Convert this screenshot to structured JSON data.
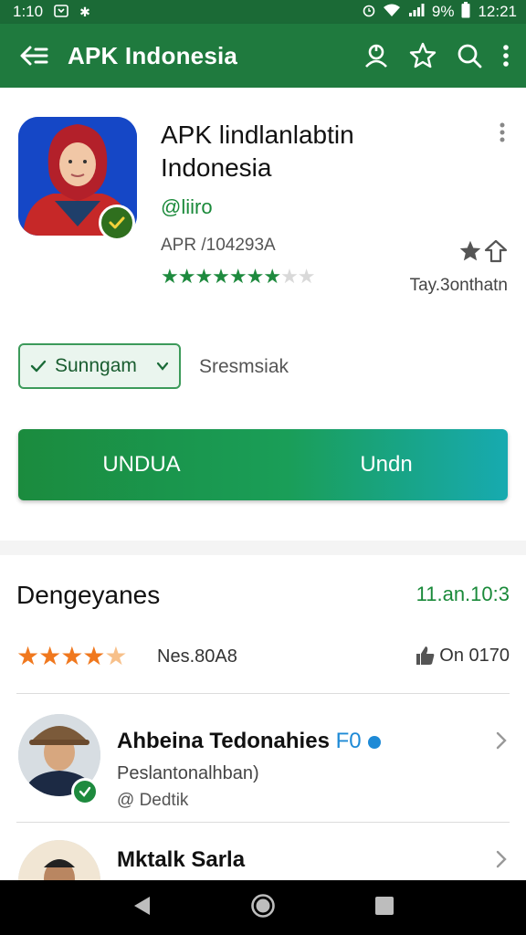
{
  "status_bar": {
    "time": "1:10",
    "right_text": "9%",
    "clock": "12:21"
  },
  "app_bar": {
    "title": "APK Indonesia"
  },
  "app": {
    "title": "APK lindlanlabtin Indonesia",
    "developer": "@liiro",
    "package": "APR /104293A",
    "rating_stars": 4.5,
    "wishlist_label": "Tay.3onthatn"
  },
  "chip": {
    "label": "Sunngam",
    "side_text": "Sresmsiak"
  },
  "install": {
    "primary_label": "UNDUA",
    "secondary_label": "Undn"
  },
  "reviews": {
    "title": "Dengeyanes",
    "date": "11.an.10:3",
    "rating_stars": 4.5,
    "count_text": "Nes.80A8",
    "meta_text": "On 0170",
    "items": [
      {
        "name": "Ahbeina Tedonahies",
        "tag": "F0",
        "subtitle": "Peslantonalhban)",
        "handle": "@ Dedtik"
      },
      {
        "name": "Mktalk Sarla"
      }
    ]
  },
  "colors": {
    "primary": "#1f7a3e",
    "accent_orange": "#f0781e",
    "install_gradient_end": "#17aab0"
  }
}
